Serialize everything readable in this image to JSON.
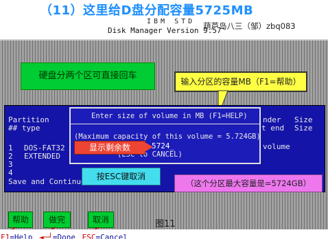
{
  "page_title": "（11）这里给D盘分配容量5725MB",
  "header": {
    "brand": "IBM STD",
    "app_line": "Disk Manager  Version 9.57'",
    "watermark": "葫芦岛八三（邹）zbq083"
  },
  "callouts": {
    "two_partitions": "硬盘分两个区可直接回车",
    "enter_size_hint": "输入分区的容量MB（F1=帮助）",
    "max_capacity": "（这个分区最大容量是=5724GB）",
    "esc_cancel": "按ESC键取消",
    "remaining": "显示剩余数"
  },
  "partition_panel": {
    "col1_header": "Partition",
    "col1_sub": "## type",
    "col2_header": "nder",
    "col2_sub": "t end",
    "col3_header": "Size",
    "col3_sub": "Size",
    "rows": [
      {
        "num": "1",
        "type": "DOS-FAT32"
      },
      {
        "num": "2",
        "type": "EXTENDED"
      },
      {
        "num": "3",
        "type": ""
      },
      {
        "num": "4",
        "type": ""
      }
    ],
    "volume_label": "volume",
    "save_continue": "Save and Continue"
  },
  "dialog": {
    "title": "Enter size of volume in MB (F1=HELP)",
    "max_capacity_line": "(Maximum capacity of this volume = 5.724GB)",
    "input_value": "5724_",
    "esc_line": "(ESC to CANCEL)"
  },
  "buttons": {
    "help": "帮助",
    "done": "做完",
    "cancel": "取消"
  },
  "figure_label": "图11",
  "footer": {
    "f1_key": "F1",
    "f1_text": "=Help",
    "enter_key": "◄─┘",
    "enter_text": "=Done",
    "esc_key": "ESC",
    "esc_text": "=Cancel"
  }
}
